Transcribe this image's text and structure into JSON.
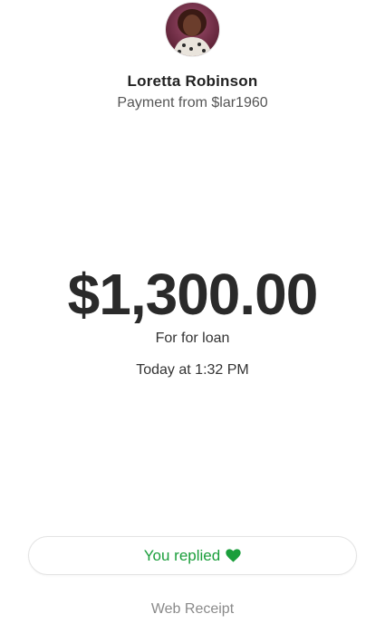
{
  "payer": {
    "name": "Loretta Robinson",
    "subtitle": "Payment from $lar1960"
  },
  "payment": {
    "amount": "$1,300.00",
    "note": "For for loan",
    "time": "Today at 1:32 PM"
  },
  "actions": {
    "replied_label": "You replied",
    "web_receipt_label": "Web Receipt"
  },
  "icons": {
    "heart": "heart-icon"
  },
  "colors": {
    "accent_green": "#1a9e3b",
    "muted_text": "#8a8a8a"
  }
}
